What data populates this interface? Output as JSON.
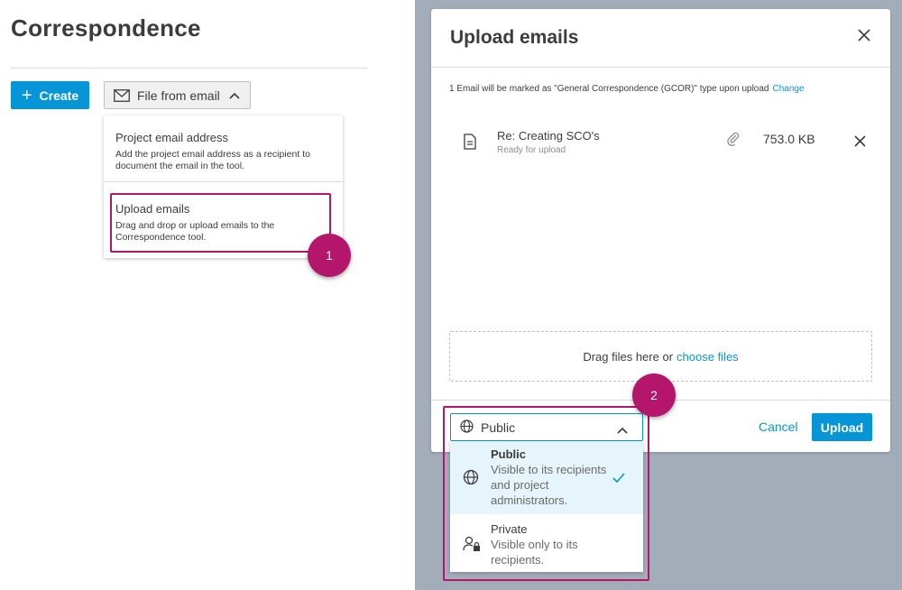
{
  "page": {
    "title": "Correspondence"
  },
  "toolbar": {
    "create_label": "Create",
    "file_from_email_label": "File from email"
  },
  "email_dropdown": {
    "items": [
      {
        "title": "Project email address",
        "description": "Add the project email address as a recipient to document the email in the tool."
      },
      {
        "title": "Upload emails",
        "description": "Drag and drop or upload emails to the Correspondence tool."
      }
    ]
  },
  "callouts": {
    "one": "1",
    "two": "2"
  },
  "modal": {
    "title": "Upload emails",
    "notice": "1 Email will be marked as \"General Correspondence (GCOR)\" type upon upload",
    "change_label": "Change",
    "file": {
      "name": "Re: Creating SCO's",
      "status": "Ready for upload",
      "size": "753.0 KB"
    },
    "dropzone_text": "Drag files here or",
    "choose_files_label": "choose files",
    "cancel_label": "Cancel",
    "upload_label": "Upload"
  },
  "visibility": {
    "selected": "Public",
    "options": [
      {
        "title": "Public",
        "description": "Visible to its recipients and project administrators."
      },
      {
        "title": "Private",
        "description": "Visible only to its recipients."
      }
    ]
  },
  "colors": {
    "accent": "#0696d7",
    "callout": "#b3166a",
    "overlay": "#a2adb9",
    "selected_option_bg": "#e6f4fb"
  },
  "icons": {
    "create": "plus-icon",
    "file_from_email": "envelope-icon",
    "file": "document-icon",
    "attachment": "paperclip-icon",
    "public": "globe-icon",
    "private": "user-lock-icon",
    "selected": "check-icon"
  }
}
